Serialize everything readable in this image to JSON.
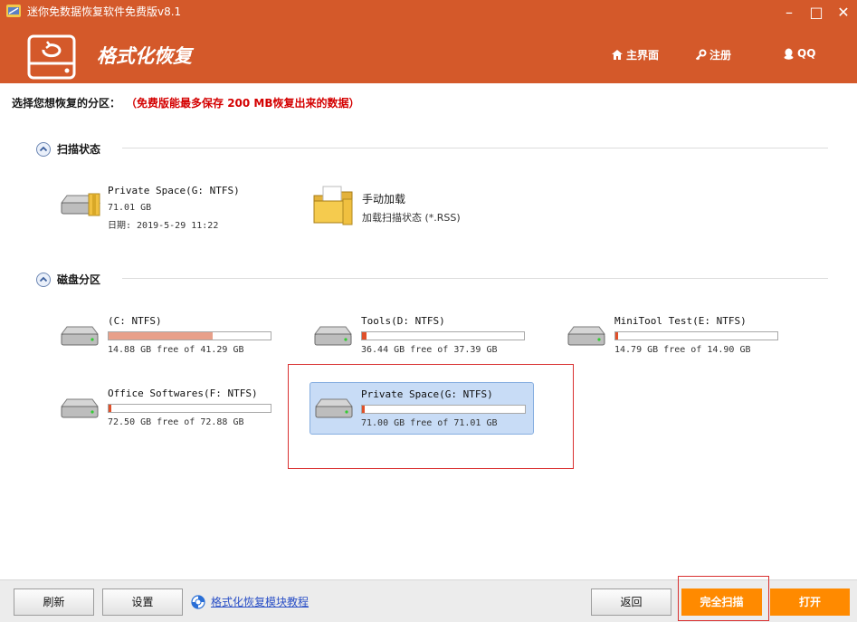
{
  "window": {
    "title": "迷你免数据恢复软件免费版v8.1",
    "minimize": "–",
    "maximize": "□",
    "close": "✕"
  },
  "header": {
    "module_title": "格式化恢复",
    "nav": {
      "home": "主界面",
      "register": "注册",
      "qq": "QQ"
    }
  },
  "instruction": {
    "label": "选择您想恢复的分区：",
    "note": "（免费版能最多保存 200 MB恢复出来的数据）"
  },
  "scan_section": {
    "title": "扫描状态",
    "items": [
      {
        "name": "Private Space(G: NTFS)",
        "size": "71.01 GB",
        "date": "日期: 2019-5-29 11:22"
      },
      {
        "name": "手动加载",
        "sub": "加载扫描状态 (*.RSS)"
      }
    ]
  },
  "partition_section": {
    "title": "磁盘分区",
    "partitions": [
      {
        "name": "(C: NTFS)",
        "free_text": "14.88 GB free of 41.29 GB",
        "used_fraction": 0.64
      },
      {
        "name": "Tools(D: NTFS)",
        "free_text": "36.44 GB free of 37.39 GB",
        "used_fraction": 0.03
      },
      {
        "name": "MiniTool Test(E: NTFS)",
        "free_text": "14.79 GB free of 14.90 GB",
        "used_fraction": 0.01
      },
      {
        "name": "Office Softwares(F: NTFS)",
        "free_text": "72.50 GB free of 72.88 GB",
        "used_fraction": 0.005
      },
      {
        "name": "Private Space(G: NTFS)",
        "free_text": "71.00 GB free of 71.01 GB",
        "used_fraction": 0.001
      }
    ]
  },
  "footer": {
    "refresh": "刷新",
    "settings": "设置",
    "tutorial": "格式化恢复模块教程",
    "back": "返回",
    "full_scan": "完全扫描",
    "open": "打开"
  },
  "colors": {
    "header_bg": "#d4592a",
    "accent_orange": "#ff8a00",
    "bar_c": "#e8a08a",
    "bar_other": "#e0502a",
    "selection": "#c8dcf6",
    "red_note": "#d40000"
  }
}
